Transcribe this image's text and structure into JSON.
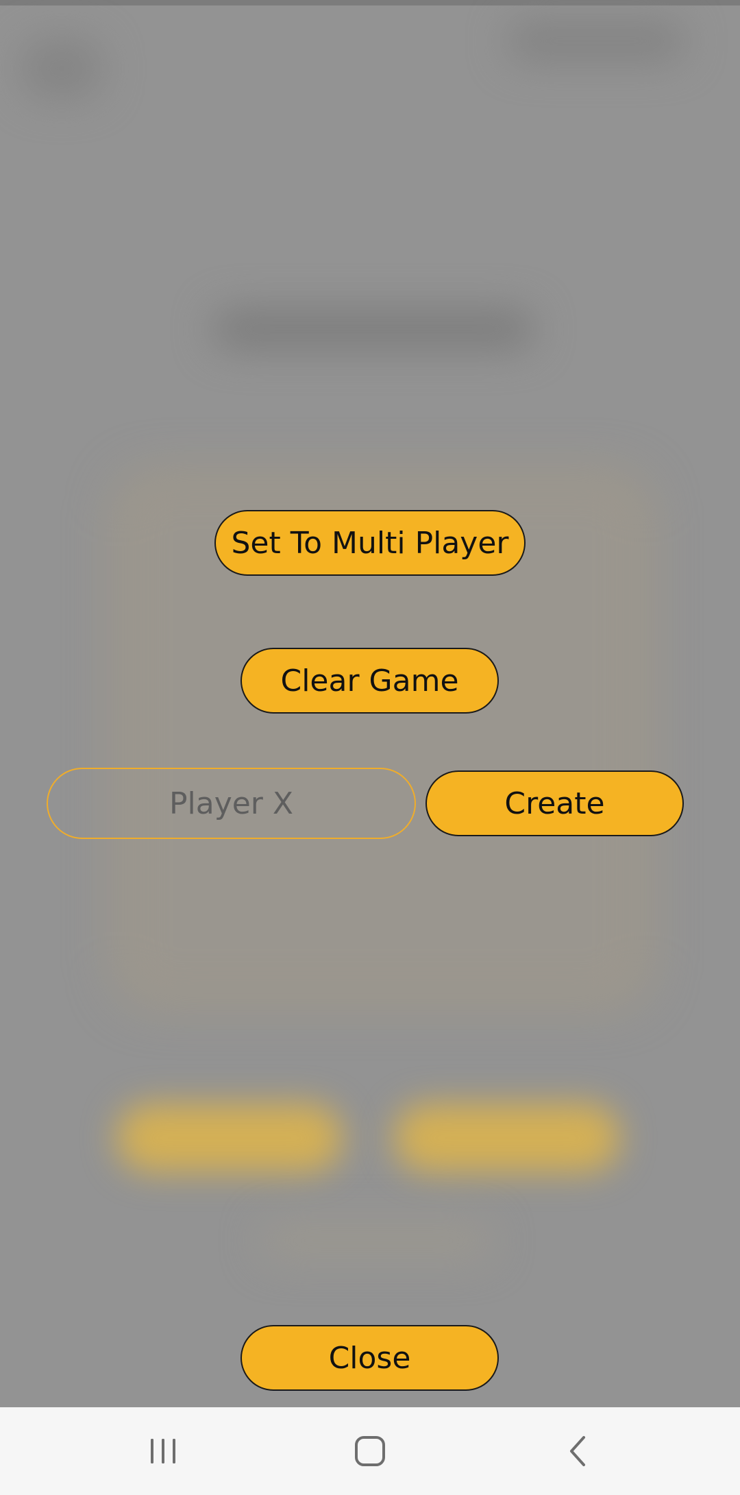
{
  "dialog": {
    "multi_player_button": "Set To Multi Player",
    "clear_game_button": "Clear Game",
    "player_name_placeholder": "Player X",
    "player_name_value": "",
    "create_button": "Create",
    "close_button": "Close"
  },
  "colors": {
    "accent": "#f5b323",
    "scrim": "#939393",
    "nav_bar": "#f6f6f6"
  },
  "nav_bar": {
    "icons": [
      "recent-apps-icon",
      "home-icon",
      "back-icon"
    ]
  }
}
